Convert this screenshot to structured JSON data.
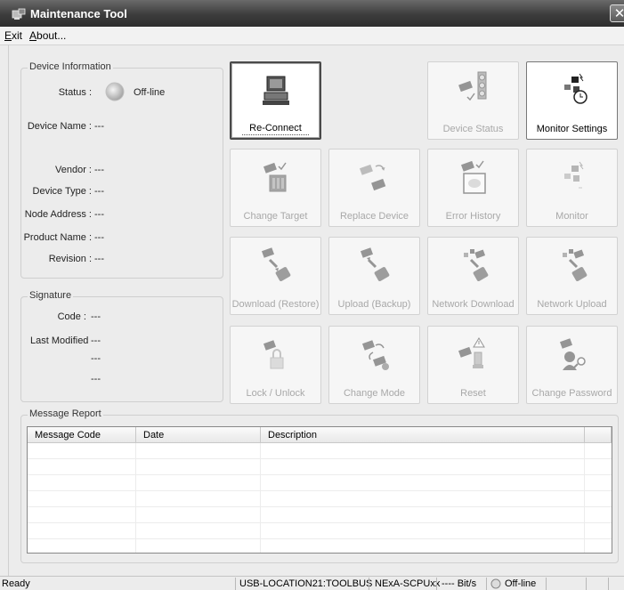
{
  "window": {
    "title": "Maintenance Tool",
    "close_glyph": "✕"
  },
  "menu": {
    "exit_accel": "E",
    "exit_rest": "xit",
    "about_accel": "A",
    "about_rest": "bout..."
  },
  "device_info": {
    "legend": "Device Information",
    "status_label": "Status :",
    "status_value": "Off-line",
    "device_name_label": "Device Name :",
    "device_name_value": "---",
    "vendor_label": "Vendor :",
    "vendor_value": "---",
    "device_type_label": "Device Type :",
    "device_type_value": "---",
    "node_address_label": "Node Address :",
    "node_address_value": "---",
    "product_name_label": "Product Name :",
    "product_name_value": "---",
    "revision_label": "Revision :",
    "revision_value": "---"
  },
  "signature": {
    "legend": "Signature",
    "code_label": "Code :",
    "code_value": "---",
    "last_modified_label": "Last Modified",
    "last_modified_value1": "---",
    "last_modified_value2": "---",
    "last_modified_value3": "---"
  },
  "tiles": {
    "reconnect": "Re-Connect",
    "device_status": "Device Status",
    "monitor_settings": "Monitor Settings",
    "change_target": "Change Target",
    "replace_device": "Replace Device",
    "error_history": "Error History",
    "monitor": "Monitor",
    "download_restore": "Download (Restore)",
    "upload_backup": "Upload (Backup)",
    "network_download": "Network Download",
    "network_upload": "Network Upload",
    "lock_unlock": "Lock / Unlock",
    "change_mode": "Change Mode",
    "reset": "Reset",
    "change_password": "Change Password"
  },
  "message_report": {
    "legend": "Message Report",
    "columns": [
      "Message Code",
      "Date",
      "Description"
    ]
  },
  "statusbar": {
    "ready": "Ready",
    "connection": "USB-LOCATION21:TOOLBUS",
    "device": "NExA-SCPUxx",
    "rate": "---- Bit/s",
    "state": "Off-line"
  },
  "colors": {
    "titlebar": "#3c3c3c",
    "panel_bg": "#ececec",
    "disabled_text": "#a8a8a8"
  }
}
